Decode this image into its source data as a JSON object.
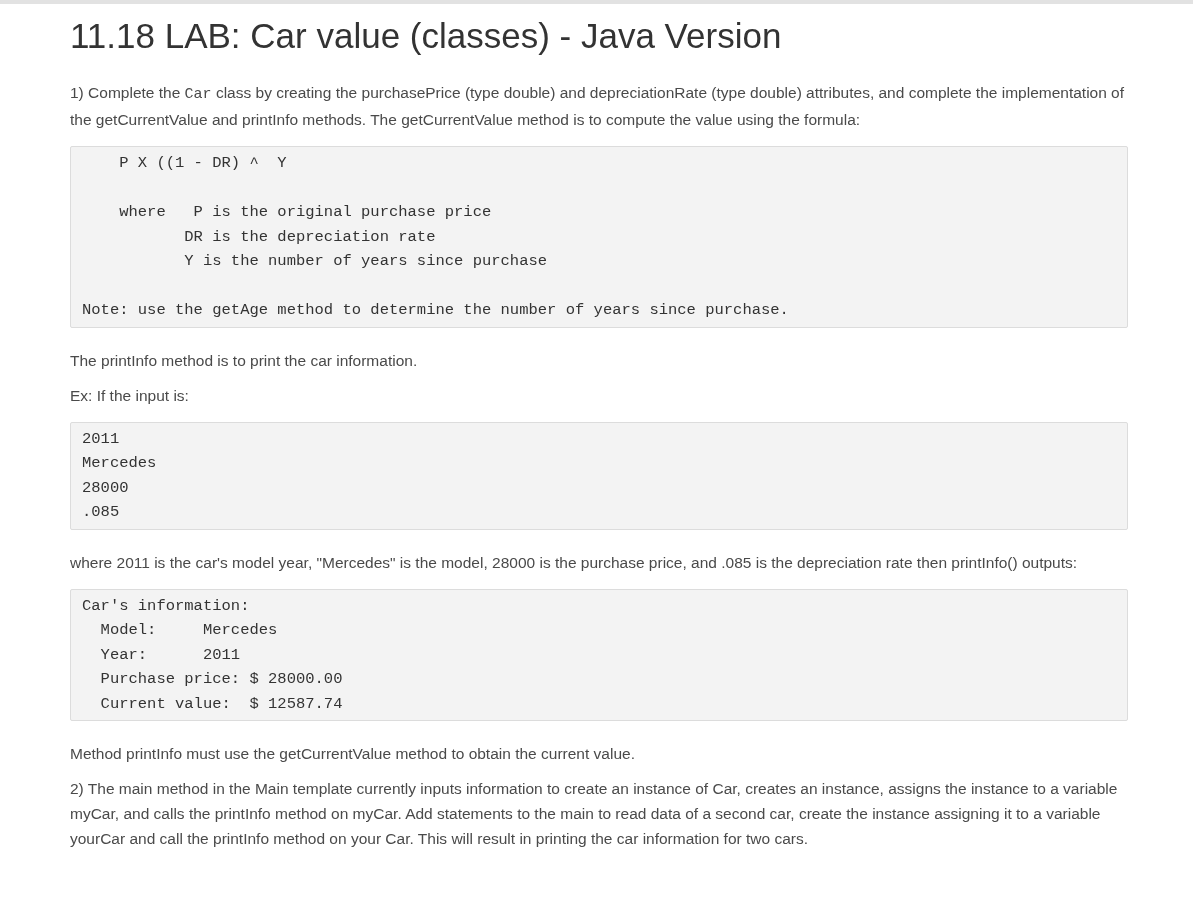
{
  "title": "11.18 LAB: Car value (classes) - Java Version",
  "blocks": [
    {
      "kind": "paragraph",
      "parts": [
        {
          "kind": "text",
          "text": "1) Complete the "
        },
        {
          "kind": "code",
          "text": "Car"
        },
        {
          "kind": "text",
          "text": " class by creating the purchasePrice (type double) and depreciationRate (type double) attributes, and complete the implementation of the getCurrentValue and printInfo methods. The getCurrentValue method is to compute the value using the formula:"
        }
      ]
    },
    {
      "kind": "code",
      "text": "    P X ((1 - DR) ^  Y\n\n    where   P is the original purchase price\n           DR is the depreciation rate\n           Y is the number of years since purchase\n\nNote: use the getAge method to determine the number of years since purchase."
    },
    {
      "kind": "paragraph",
      "parts": [
        {
          "kind": "text",
          "text": "The printInfo method is to print the car information."
        }
      ]
    },
    {
      "kind": "paragraph",
      "parts": [
        {
          "kind": "text",
          "text": "Ex: If the input is:"
        }
      ]
    },
    {
      "kind": "code",
      "text": "2011\nMercedes\n28000\n.085"
    },
    {
      "kind": "paragraph",
      "parts": [
        {
          "kind": "text",
          "text": "where 2011 is the car's model year, \"Mercedes\" is the model, 28000 is the purchase price, and .085 is the depreciation rate then printInfo() outputs:"
        }
      ]
    },
    {
      "kind": "code",
      "text": "Car's information:\n  Model:     Mercedes\n  Year:      2011\n  Purchase price: $ 28000.00\n  Current value:  $ 12587.74"
    },
    {
      "kind": "paragraph",
      "parts": [
        {
          "kind": "text",
          "text": "Method printInfo must use the getCurrentValue method to obtain the current value."
        }
      ]
    },
    {
      "kind": "paragraph",
      "parts": [
        {
          "kind": "text",
          "text": "2) The main method in the Main template currently inputs information to create an instance of Car, creates an instance, assigns the instance to a variable myCar, and calls the printInfo method on myCar. Add statements to the main to read data of a second car, create the instance assigning it to a variable yourCar and call the printInfo method on your Car. This will result in printing the car information for two cars."
        }
      ]
    }
  ]
}
